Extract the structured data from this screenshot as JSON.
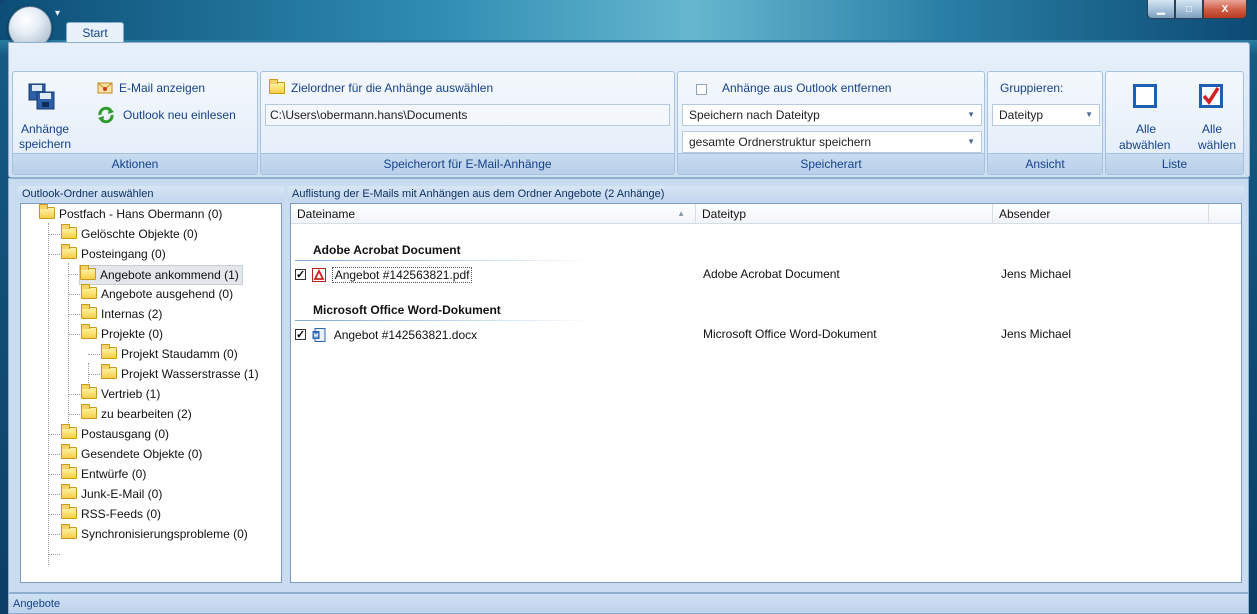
{
  "window": {
    "qat_label": "▾",
    "controls": {
      "minimize": "▁",
      "maximize": "□",
      "close": "X"
    }
  },
  "ribbon": {
    "tab_start": "Start",
    "aktionen": {
      "save_label_1": "Anhänge",
      "save_label_2": "speichern",
      "show_mail": "E-Mail anzeigen",
      "reload": "Outlook neu einlesen",
      "group_label": "Aktionen"
    },
    "speicherort": {
      "choose_folder": "Zielordner für die Anhänge auswählen",
      "path": "C:\\Users\\obermann.hans\\Documents",
      "group_label": "Speicherort für E-Mail-Anhänge"
    },
    "speicherart": {
      "remove_label": "Anhänge aus Outlook entfernen",
      "mode_select": "Speichern nach Dateityp",
      "structure_select": "gesamte Ordnerstruktur speichern",
      "group_label": "Speicherart"
    },
    "ansicht": {
      "group_by_label": "Gruppieren:",
      "group_by_value": "Dateityp",
      "group_label": "Ansicht"
    },
    "liste": {
      "deselect_1": "Alle",
      "deselect_2": "abwählen",
      "select_1": "Alle",
      "select_2": "wählen",
      "group_label": "Liste"
    }
  },
  "folder_panel": {
    "title": "Outlook-Ordner auswählen",
    "nodes": [
      "Postfach - Hans Obermann (0)",
      "Gelöschte Objekte (0)",
      "Posteingang (0)",
      "Angebote ankommend (1)",
      "Angebote ausgehend (0)",
      "Internas (2)",
      "Projekte (0)",
      "Projekt Staudamm (0)",
      "Projekt Wasserstrasse (1)",
      "Vertrieb (1)",
      "zu bearbeiten (2)",
      "Postausgang (0)",
      "Gesendete Objekte (0)",
      "Entwürfe (0)",
      "Junk-E-Mail (0)",
      "RSS-Feeds (0)",
      "Synchronisierungsprobleme (0)"
    ]
  },
  "list_panel": {
    "title": "Auflistung der E-Mails mit Anhängen aus dem Ordner Angebote (2 Anhänge)",
    "columns": [
      "Dateiname",
      "Dateityp",
      "Absender"
    ],
    "groups": [
      {
        "name": "Adobe Acrobat Document",
        "rows": [
          {
            "file": "Angebot #142563821.pdf",
            "type": "Adobe Acrobat Document",
            "sender": "Jens Michael"
          }
        ]
      },
      {
        "name": "Microsoft Office Word-Dokument",
        "rows": [
          {
            "file": "Angebot #142563821.docx",
            "type": "Microsoft Office Word-Dokument",
            "sender": "Jens Michael"
          }
        ]
      }
    ]
  },
  "status": {
    "text": "Angebote"
  }
}
